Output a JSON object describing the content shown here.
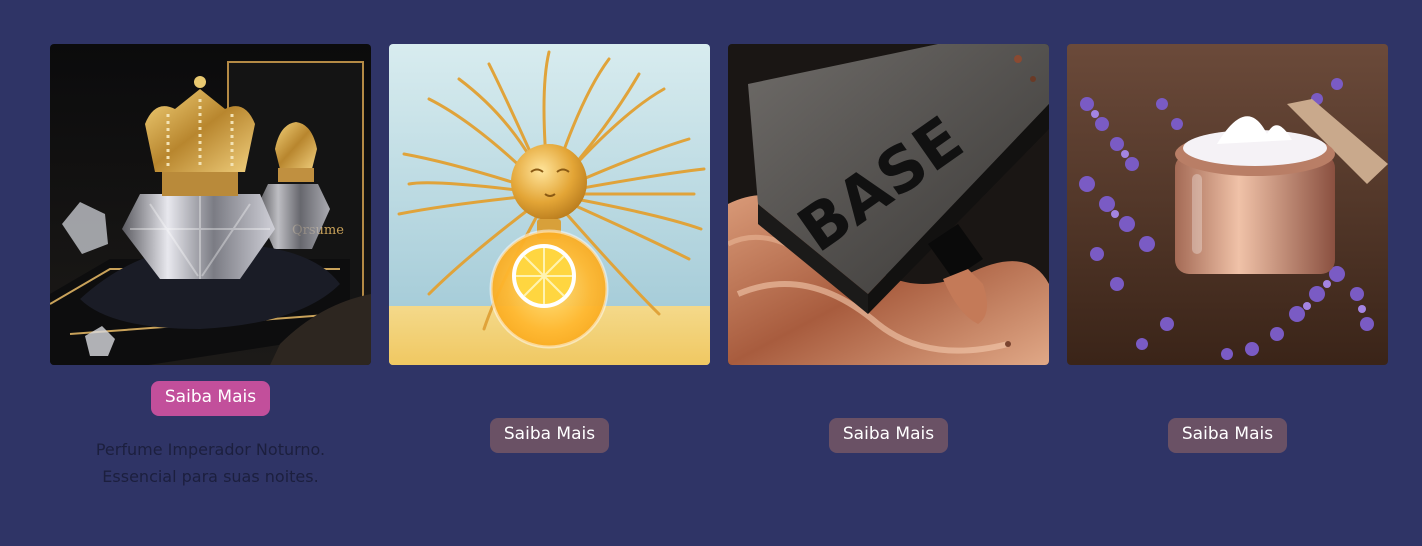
{
  "products": [
    {
      "image_icon": "crown-perfume-image",
      "button_label": "Saiba Mais",
      "description_lines": [
        "Perfume Imperador Noturno.",
        "Essencial para suas noites."
      ],
      "active": true
    },
    {
      "image_icon": "sun-perfume-image",
      "button_label": "Saiba Mais",
      "active": false
    },
    {
      "image_icon": "foundation-base-image",
      "image_text": "BASE",
      "button_label": "Saiba Mais",
      "active": false
    },
    {
      "image_icon": "lavender-cream-image",
      "button_label": "Saiba Mais",
      "active": false
    }
  ],
  "colors": {
    "background": "#2f3466",
    "button_active": "#c24f9b",
    "button_muted": "#6a5165"
  }
}
